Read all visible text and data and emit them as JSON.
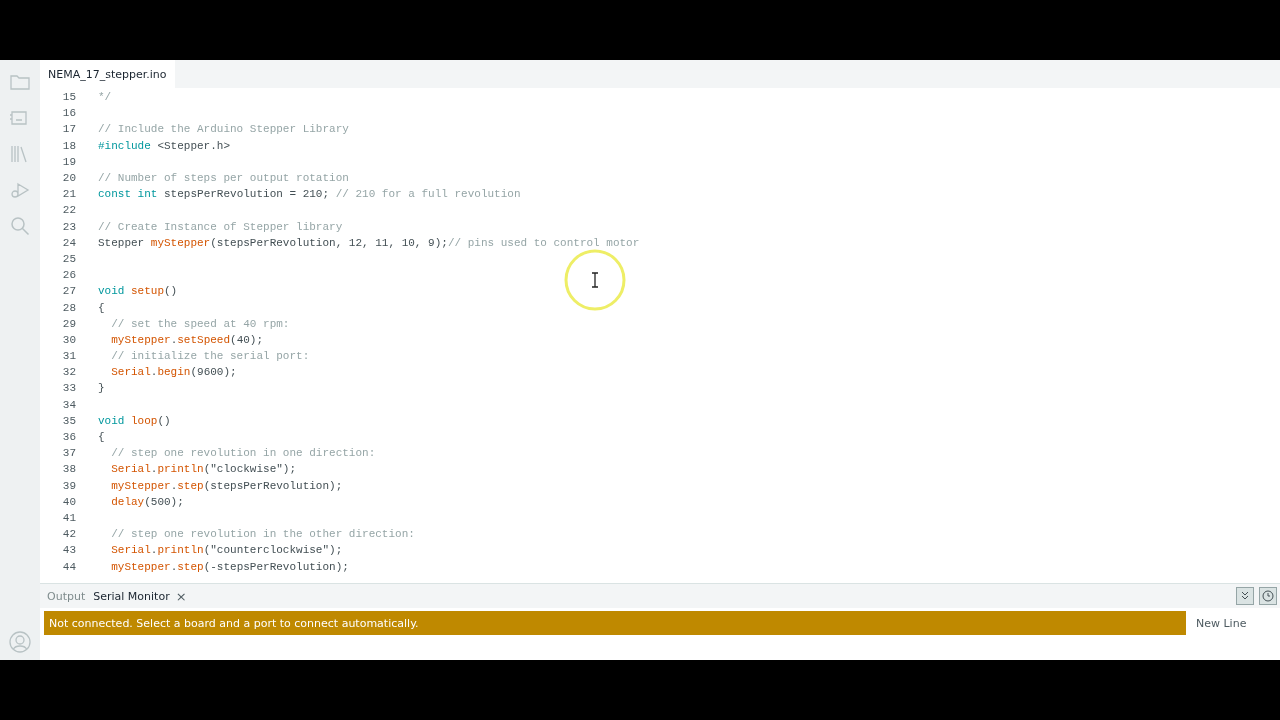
{
  "editor_tabs": [
    {
      "label": "NEMA_17_stepper.ino",
      "selected": true
    }
  ],
  "code_lines": [
    {
      "number": "15",
      "tokens": [
        {
          "kind": "comment",
          "text": "*/"
        }
      ]
    },
    {
      "number": "16"
    },
    {
      "number": "17",
      "tokens": [
        {
          "kind": "comment",
          "text": "// Include the Arduino Stepper Library"
        }
      ]
    },
    {
      "number": "18",
      "tokens": [
        {
          "kind": "keyword",
          "text": "#include"
        },
        {
          "kind": "plain",
          "text": " <Stepper.h>"
        }
      ]
    },
    {
      "number": "19"
    },
    {
      "number": "20",
      "tokens": [
        {
          "kind": "comment",
          "text": "// Number of steps per output rotation"
        }
      ]
    },
    {
      "number": "21",
      "tokens": [
        {
          "kind": "keyword",
          "text": "const int"
        },
        {
          "kind": "plain",
          "text": " stepsPerRevolution = 210; "
        },
        {
          "kind": "comment",
          "text": "// 210 for a full revolution"
        }
      ]
    },
    {
      "number": "22"
    },
    {
      "number": "23",
      "tokens": [
        {
          "kind": "comment",
          "text": "// Create Instance of Stepper library"
        }
      ]
    },
    {
      "number": "24",
      "tokens": [
        {
          "kind": "plain",
          "text": "Stepper "
        },
        {
          "kind": "function",
          "text": "myStepper"
        },
        {
          "kind": "plain",
          "text": "(stepsPerRevolution, 12, 11, 10, 9);"
        },
        {
          "kind": "comment",
          "text": "// pins used to control motor"
        }
      ]
    },
    {
      "number": "25"
    },
    {
      "number": "26"
    },
    {
      "number": "27",
      "tokens": [
        {
          "kind": "keyword",
          "text": "void"
        },
        {
          "kind": "function",
          "text": " setup"
        },
        {
          "kind": "plain",
          "text": "()"
        }
      ]
    },
    {
      "number": "28",
      "tokens": [
        {
          "kind": "plain",
          "text": "{"
        }
      ]
    },
    {
      "number": "29",
      "tokens": [
        {
          "kind": "comment",
          "text": "  // set the speed at 40 rpm:"
        }
      ]
    },
    {
      "number": "30",
      "tokens": [
        {
          "kind": "function",
          "text": "  myStepper"
        },
        {
          "kind": "plain",
          "text": "."
        },
        {
          "kind": "function",
          "text": "setSpeed"
        },
        {
          "kind": "plain",
          "text": "(40);"
        }
      ]
    },
    {
      "number": "31",
      "tokens": [
        {
          "kind": "comment",
          "text": "  // initialize the serial port:"
        }
      ]
    },
    {
      "number": "32",
      "tokens": [
        {
          "kind": "function",
          "text": "  Serial"
        },
        {
          "kind": "plain",
          "text": "."
        },
        {
          "kind": "function",
          "text": "begin"
        },
        {
          "kind": "plain",
          "text": "(9600);"
        }
      ]
    },
    {
      "number": "33",
      "tokens": [
        {
          "kind": "plain",
          "text": "}"
        }
      ]
    },
    {
      "number": "34"
    },
    {
      "number": "35",
      "tokens": [
        {
          "kind": "keyword",
          "text": "void"
        },
        {
          "kind": "function",
          "text": " loop"
        },
        {
          "kind": "plain",
          "text": "()"
        }
      ]
    },
    {
      "number": "36",
      "tokens": [
        {
          "kind": "plain",
          "text": "{"
        }
      ]
    },
    {
      "number": "37",
      "tokens": [
        {
          "kind": "comment",
          "text": "  // step one revolution in one direction:"
        }
      ]
    },
    {
      "number": "38",
      "tokens": [
        {
          "kind": "function",
          "text": "  Serial"
        },
        {
          "kind": "plain",
          "text": "."
        },
        {
          "kind": "function",
          "text": "println"
        },
        {
          "kind": "plain",
          "text": "(\"clockwise\");"
        }
      ]
    },
    {
      "number": "39",
      "tokens": [
        {
          "kind": "function",
          "text": "  myStepper"
        },
        {
          "kind": "plain",
          "text": "."
        },
        {
          "kind": "function",
          "text": "step"
        },
        {
          "kind": "plain",
          "text": "(stepsPerRevolution);"
        }
      ]
    },
    {
      "number": "40",
      "tokens": [
        {
          "kind": "function",
          "text": "  delay"
        },
        {
          "kind": "plain",
          "text": "(500);"
        }
      ]
    },
    {
      "number": "41"
    },
    {
      "number": "42",
      "tokens": [
        {
          "kind": "comment",
          "text": "  // step one revolution in the other direction:"
        }
      ]
    },
    {
      "number": "43",
      "tokens": [
        {
          "kind": "function",
          "text": "  Serial"
        },
        {
          "kind": "plain",
          "text": "."
        },
        {
          "kind": "function",
          "text": "println"
        },
        {
          "kind": "plain",
          "text": "(\"counterclockwise\");"
        }
      ]
    },
    {
      "number": "44",
      "tokens": [
        {
          "kind": "function",
          "text": "  myStepper"
        },
        {
          "kind": "plain",
          "text": "."
        },
        {
          "kind": "function",
          "text": "step"
        },
        {
          "kind": "plain",
          "text": "(-stepsPerRevolution);"
        }
      ]
    }
  ],
  "panel_tabs": [
    {
      "label": "Output",
      "selected": false,
      "closable": false
    },
    {
      "label": "Serial Monitor",
      "selected": true,
      "closable": true
    }
  ],
  "close_symbol": "×",
  "notice": "Not connected. Select a board and a port to connect automatically.",
  "line_ending": "New Line"
}
